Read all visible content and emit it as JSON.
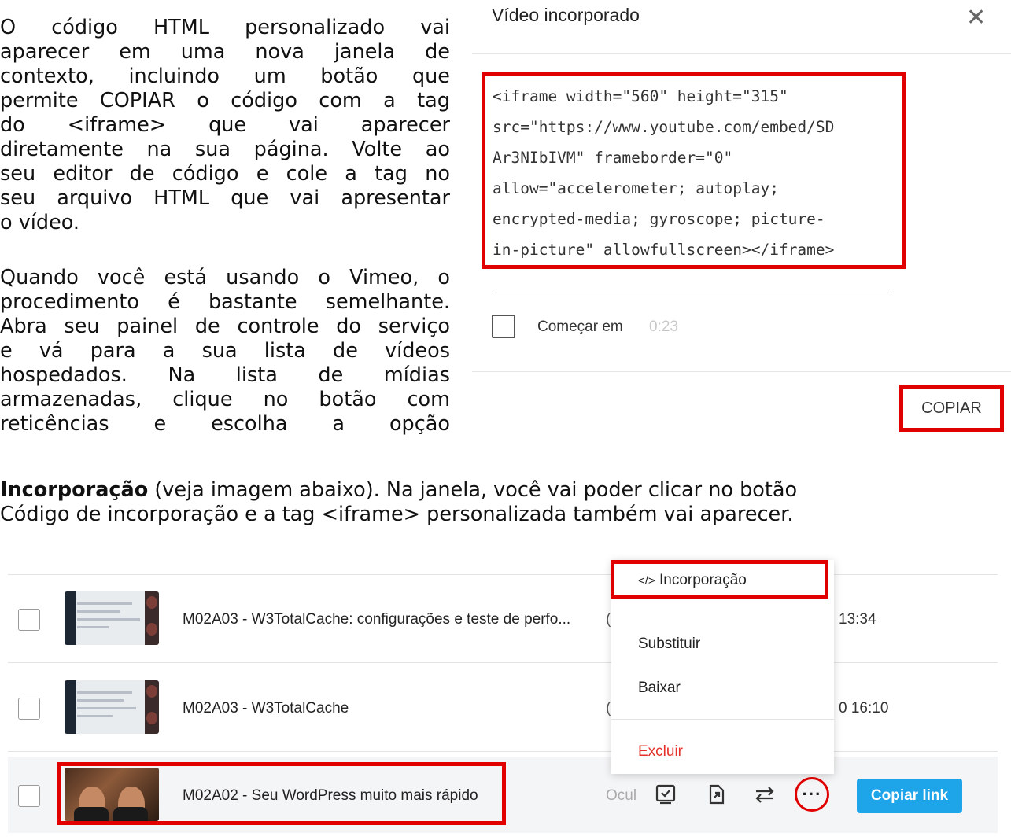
{
  "paragraph_1": {
    "lines": [
      "O código HTML personalizado vai",
      "aparecer em uma nova janela de",
      "contexto, incluindo um botão que",
      "permite COPIAR o código com a tag",
      "do <iframe> que vai aparecer",
      "diretamente na sua página. Volte ao",
      "seu editor de código e cole a tag no",
      "seu arquivo HTML que vai apresentar",
      "o vídeo."
    ]
  },
  "paragraph_2": {
    "lines": [
      "Quando você está usando o Vimeo, o",
      "procedimento é bastante semelhante.",
      "Abra seu painel de controle do serviço",
      "e vá para a sua lista de vídeos",
      "hospedados. Na lista de mídias",
      "armazenadas, clique no botão com",
      "reticências e escolha a opção"
    ],
    "bold_term": "Incorporação",
    "line_8_rest": " (veja imagem abaixo). Na janela, você vai poder clicar no botão",
    "line_9": "Código de incorporação e a tag <iframe> personalizada também vai aparecer."
  },
  "embed_dialog": {
    "title": "Vídeo incorporado",
    "close_icon": "close-icon",
    "code": "<iframe width=\"560\" height=\"315\"\nsrc=\"https://www.youtube.com/embed/SD\nAr3NIbIVM\" frameborder=\"0\"\nallow=\"accelerometer; autoplay;\nencrypted-media; gyroscope; picture-\nin-picture\" allowfullscreen></iframe>",
    "start_label": "Começar em",
    "start_time": "0:23",
    "copy_label": "COPIAR",
    "highlight_color": "#e10000"
  },
  "vimeo_list": {
    "rows": [
      {
        "title": "M02A03 - W3TotalCache: configurações e teste de perfo...",
        "status_fragment": "(",
        "time_fragment": "13:34"
      },
      {
        "title": "M02A03 - W3TotalCache",
        "status_fragment": "(",
        "time_fragment": "0 16:10"
      },
      {
        "title": "M02A02 - Seu WordPress muito mais rápido",
        "status_fragment": "Ocul"
      }
    ],
    "actions": [
      "review-icon",
      "share-icon",
      "swap-icon",
      "more-icon"
    ],
    "more_glyph": "···",
    "copy_link_label": "Copiar link",
    "accent_color": "#1ea4e9",
    "menu": {
      "embed_icon": "</>",
      "embed_label": "Incorporação",
      "items": [
        "Substituir",
        "Baixar"
      ],
      "delete_label": "Excluir"
    }
  }
}
